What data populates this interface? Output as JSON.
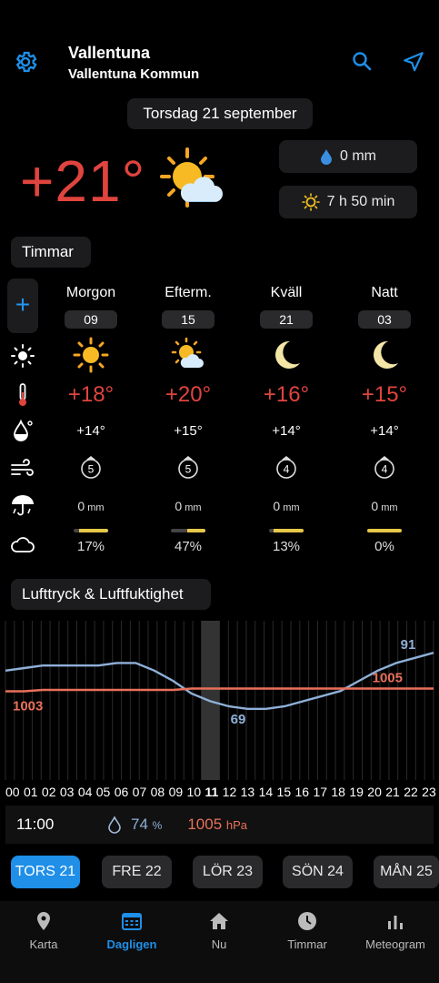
{
  "header": {
    "location_name": "Vallentuna",
    "location_sub": "Vallentuna Kommun"
  },
  "date_label": "Torsdag 21 september",
  "current": {
    "temp": "+21°",
    "rain": "0 mm",
    "sun": "7 h 50 min"
  },
  "section_hours": "Timmar",
  "periods": [
    {
      "label": "Morgon",
      "hour": "09",
      "temp": "+18°",
      "feels": "+14°",
      "wind": "5",
      "rain": "0",
      "rain_unit": "mm",
      "cloud": "17%",
      "cloud_frac": 0.17,
      "icon": "sun-icon"
    },
    {
      "label": "Efterm.",
      "hour": "15",
      "temp": "+20°",
      "feels": "+15°",
      "wind": "5",
      "rain": "0",
      "rain_unit": "mm",
      "cloud": "47%",
      "cloud_frac": 0.47,
      "icon": "sun-cloud-icon"
    },
    {
      "label": "Kväll",
      "hour": "21",
      "temp": "+16°",
      "feels": "+14°",
      "wind": "4",
      "rain": "0",
      "rain_unit": "mm",
      "cloud": "13%",
      "cloud_frac": 0.13,
      "icon": "moon-icon"
    },
    {
      "label": "Natt",
      "hour": "03",
      "temp": "+15°",
      "feels": "+14°",
      "wind": "4",
      "rain": "0",
      "rain_unit": "mm",
      "cloud": "0%",
      "cloud_frac": 0.0,
      "icon": "moon-icon"
    }
  ],
  "section_pressure": "Lufttryck & Luftfuktighet",
  "chart_data": {
    "type": "line",
    "x": [
      "00",
      "01",
      "02",
      "03",
      "04",
      "05",
      "06",
      "07",
      "08",
      "09",
      "10",
      "11",
      "12",
      "13",
      "14",
      "15",
      "16",
      "17",
      "18",
      "19",
      "20",
      "21",
      "22",
      "23"
    ],
    "series": [
      {
        "values": [
          84,
          85,
          86,
          86,
          86,
          86,
          87,
          87,
          84,
          80,
          75,
          72,
          70,
          69,
          69,
          70,
          72,
          74,
          76,
          80,
          84,
          87,
          89,
          91
        ]
      },
      {
        "values": [
          1003,
          1003,
          1004,
          1004,
          1004,
          1004,
          1004,
          1004,
          1004,
          1004,
          1005,
          1005,
          1005,
          1005,
          1005,
          1005,
          1005,
          1005,
          1005,
          1005,
          1005,
          1005,
          1005,
          1005
        ]
      }
    ],
    "labels": {
      "humidity_max": "91",
      "humidity_min": "69",
      "pressure_start": "1003",
      "pressure_end": "1005"
    },
    "highlight_hour": "11",
    "colors": {
      "humidity": "#8fb0d8",
      "pressure": "#e8705a"
    }
  },
  "hours_axis": [
    "00",
    "01",
    "02",
    "03",
    "04",
    "05",
    "06",
    "07",
    "08",
    "09",
    "10",
    "11",
    "12",
    "13",
    "14",
    "15",
    "16",
    "17",
    "18",
    "19",
    "20",
    "21",
    "22",
    "23"
  ],
  "info": {
    "time": "11:00",
    "humidity": "74",
    "humidity_unit": "%",
    "pressure": "1005",
    "pressure_unit": "hPa"
  },
  "days": [
    {
      "name": "TORS",
      "num": "21",
      "active": true
    },
    {
      "name": "FRE",
      "num": "22"
    },
    {
      "name": "LÖR",
      "num": "23"
    },
    {
      "name": "SÖN",
      "num": "24"
    },
    {
      "name": "MÅN",
      "num": "25"
    }
  ],
  "nav": [
    {
      "label": "Karta",
      "icon": "map-pin-icon"
    },
    {
      "label": "Dagligen",
      "icon": "calendar-icon",
      "active": true
    },
    {
      "label": "Nu",
      "icon": "home-icon"
    },
    {
      "label": "Timmar",
      "icon": "clock-icon"
    },
    {
      "label": "Meteogram",
      "icon": "bar-chart-icon"
    }
  ],
  "colors": {
    "accent": "#1f8fe8",
    "temp_red": "#e0443e"
  }
}
